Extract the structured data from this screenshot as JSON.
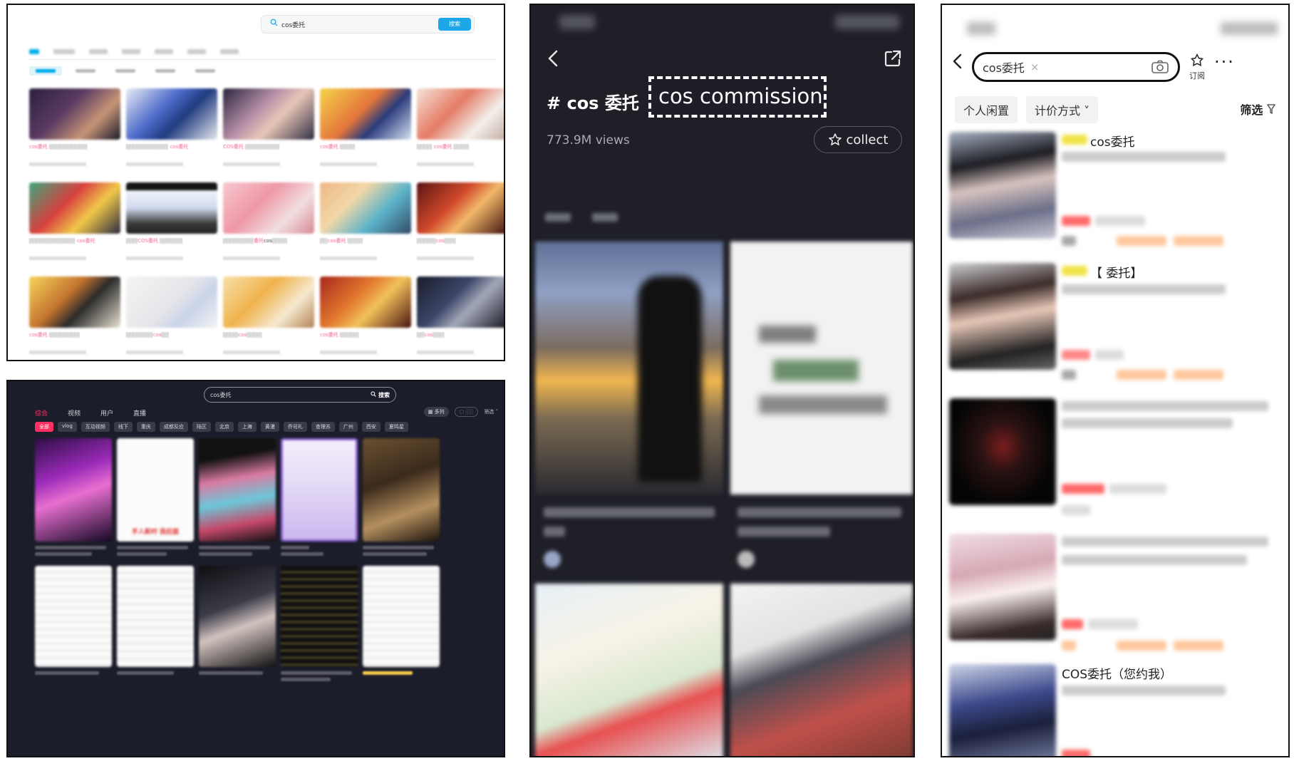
{
  "panel1": {
    "search_query": "cos委托",
    "search_button": "搜索",
    "titles_prefix": "cos委托"
  },
  "panel2": {
    "search_query": "cos委托",
    "search_button": "搜索",
    "tabs": [
      "综合",
      "视频",
      "用户",
      "直播"
    ],
    "chips": [
      "全部",
      "vlog",
      "互动视频",
      "线下",
      "重庆",
      "成都反应",
      "陆区",
      "北京",
      "上海",
      "黄漫",
      "乔司礼",
      "查理苏",
      "广州",
      "西安",
      "夏鸣星"
    ],
    "view_toggle": "多列",
    "filter_label": "筛选",
    "card2_text": "手人新时 我后面"
  },
  "panel3": {
    "title": "# cos 委托",
    "annotation": "cos commission",
    "views": "773.9M views",
    "collect_label": "collect"
  },
  "panel4": {
    "search_query": "cos委托",
    "clear_icon": "×",
    "subscribe_label": "订阅",
    "more_label": "···",
    "filters": [
      "个人闲置",
      "计价方式 ˅"
    ],
    "filter_right": "筛选",
    "items": [
      {
        "title": "cos委托"
      },
      {
        "title": "【 委托】"
      },
      {
        "title": ""
      },
      {
        "title": ""
      },
      {
        "title": "COS委托（您约我）"
      }
    ]
  },
  "colors": {
    "bilibili_blue": "#00aeec",
    "bilibili_pink": "#f25d8e",
    "douyin_red": "#ff2e63",
    "xianyu_orange": "#ffb37a"
  }
}
